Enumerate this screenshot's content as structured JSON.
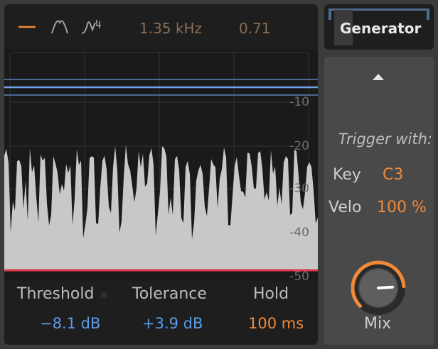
{
  "filter": {
    "icons": [
      "flat-line-icon",
      "bell-curve-icon",
      "shelf-curve-icon"
    ],
    "frequency": "1.35 kHz",
    "q": "0.71"
  },
  "graph": {
    "db_labels": [
      "-10",
      "-20",
      "-30",
      "-40",
      "-50"
    ],
    "waveform_color": "#c8c8c8",
    "threshold_line_color": "#e0384a",
    "tolerance_line_color": "#6fa0e6"
  },
  "params": {
    "threshold_label": "Threshold",
    "threshold_value": "−8.1 dB",
    "tolerance_label": "Tolerance",
    "tolerance_value": "+3.9 dB",
    "hold_label": "Hold",
    "hold_value": "100 ms"
  },
  "generator": {
    "title": "Generator",
    "trigger_label": "Trigger with:",
    "key_label": "Key",
    "key_value": "C3",
    "velo_label": "Velo",
    "velo_value": "100 %",
    "mix_label": "Mix",
    "mix_level": 0.82
  },
  "colors": {
    "accent_orange": "#f08a3a",
    "accent_blue": "#5b9de8"
  }
}
